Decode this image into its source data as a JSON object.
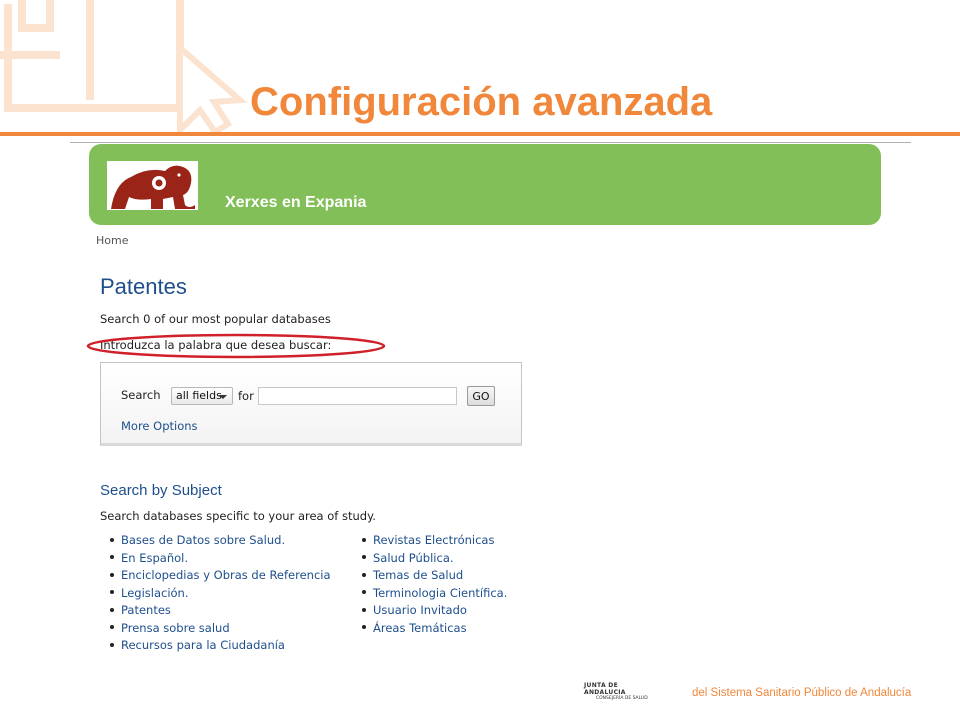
{
  "slide": {
    "title": "Configuración avanzada",
    "accent_color": "#f0873a",
    "footer_logo_line1": "JUNTA DE ANDALUCIA",
    "footer_logo_line2": "CONSEJERÍA DE SALUD",
    "footer_text": "del Sistema Sanitario Público de Andalucía"
  },
  "header": {
    "background_color": "#83bf59",
    "logo_icon": "elephant-logo-icon",
    "brand_name": "Xerxes en Expania"
  },
  "breadcrumb": {
    "home_label": "Home"
  },
  "main": {
    "page_title": "Patentes",
    "intro_line": "Search 0 of our most popular databases",
    "prompt_line": "Introduzca la palabra que desea buscar:",
    "highlight_color": "#d0202a"
  },
  "search": {
    "search_label": "Search",
    "field_selected": "all fields",
    "for_label": "for",
    "query_value": "",
    "go_label": "GO",
    "more_options_label": "More Options"
  },
  "subjects": {
    "heading": "Search by Subject",
    "description": "Search databases specific to your area of study.",
    "column1": [
      "Bases de Datos sobre Salud.",
      "En Español.",
      "Enciclopedias y Obras de Referencia",
      "Legislación.",
      "Patentes",
      "Prensa sobre salud",
      "Recursos para la Ciudadanía"
    ],
    "column2": [
      "Revistas Electrónicas",
      "Salud Pública.",
      "Temas de Salud",
      "Terminologia Científica.",
      "Usuario Invitado",
      "Áreas Temáticas"
    ]
  }
}
